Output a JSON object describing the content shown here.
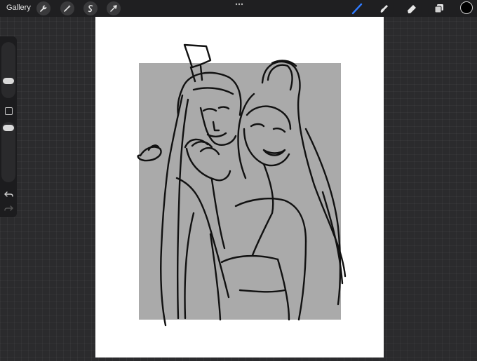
{
  "topbar": {
    "gallery_label": "Gallery",
    "left_tools": [
      "wrench-icon",
      "magic-wand-icon",
      "selection-icon",
      "transform-icon"
    ],
    "right_tools": [
      "brush-icon",
      "smudge-icon",
      "eraser-icon",
      "layers-icon"
    ],
    "active_tool": "brush-icon",
    "active_color": "#000000",
    "accent": "#2f7bff"
  },
  "sidebar": {
    "controls": [
      "brush-size-slider",
      "modify-button",
      "opacity-slider",
      "undo-icon",
      "redo-icon"
    ]
  }
}
